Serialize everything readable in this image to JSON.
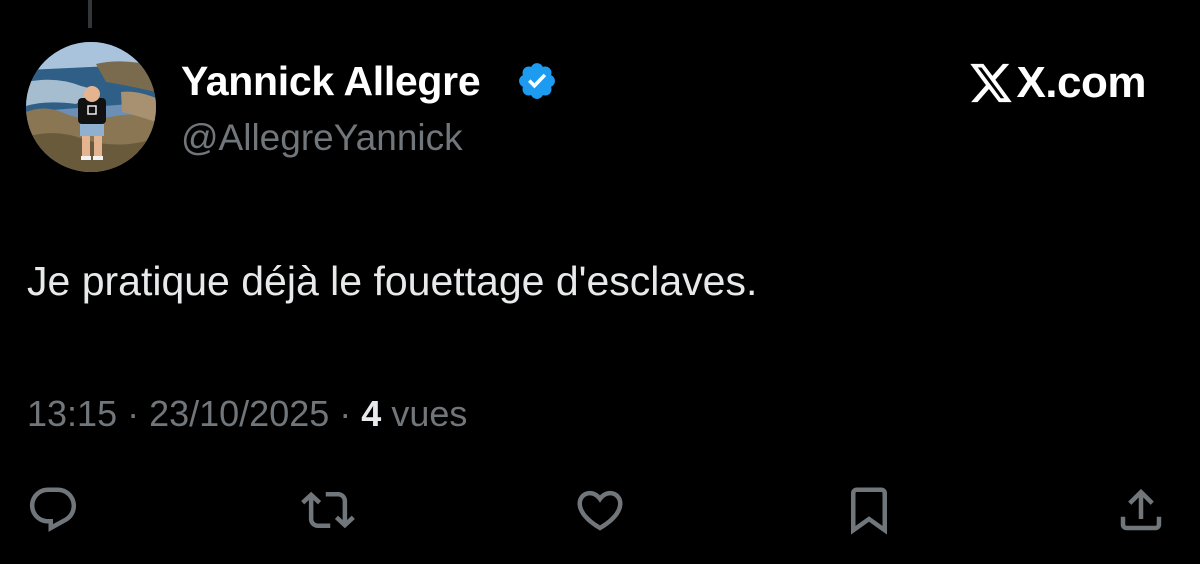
{
  "tweet": {
    "author": {
      "display_name": "Yannick Allegre",
      "handle": "@AllegreYannick",
      "verified": true
    },
    "brand": "X.com",
    "text": "Je pratique déjà le fouettage d'esclaves.",
    "meta": {
      "time": "13:15",
      "separator": " · ",
      "date": "23/10/2025",
      "views_count": "4",
      "views_label": "vues"
    },
    "actions": [
      {
        "name": "reply",
        "icon": "reply-icon"
      },
      {
        "name": "retweet",
        "icon": "retweet-icon"
      },
      {
        "name": "like",
        "icon": "heart-icon"
      },
      {
        "name": "bookmark",
        "icon": "bookmark-icon"
      },
      {
        "name": "share",
        "icon": "share-icon"
      }
    ]
  },
  "colors": {
    "background": "#000000",
    "primary_text": "#e7e9ea",
    "secondary_text": "#71767b",
    "verified_blue": "#1d9bf0"
  }
}
